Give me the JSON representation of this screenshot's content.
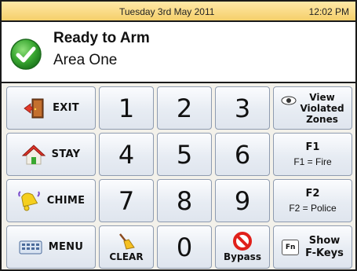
{
  "status": {
    "date": "Tuesday 3rd May 2011",
    "time": "12:02 PM"
  },
  "arm": {
    "title": "Ready to Arm",
    "area": "Area One"
  },
  "keys": {
    "exit": "EXIT",
    "stay": "STAY",
    "chime": "CHIME",
    "menu": "MENU",
    "clear": "CLEAR",
    "bypass": "Bypass",
    "n1": "1",
    "n2": "2",
    "n3": "3",
    "n4": "4",
    "n5": "5",
    "n6": "6",
    "n7": "7",
    "n8": "8",
    "n9": "9",
    "n0": "0",
    "view_line1": "View",
    "view_line2": "Violated",
    "view_line3": "Zones",
    "f1": "F1",
    "f1_sub": "F1 = Fire",
    "f2": "F2",
    "f2_sub": "F2 = Police",
    "fn_icon_text": "Fn",
    "show_line1": "Show",
    "show_line2": "F-Keys"
  },
  "colors": {
    "status_bar": "#f5cf6a",
    "check_green": "#3aa832",
    "key_border": "#8e9bb0"
  },
  "icons": {
    "status": "checkmark-icon",
    "exit": "exit-door-icon",
    "stay": "house-icon",
    "chime": "bell-icon",
    "menu": "keyboard-icon",
    "clear": "broom-icon",
    "bypass": "no-entry-icon",
    "view": "eye-icon"
  }
}
